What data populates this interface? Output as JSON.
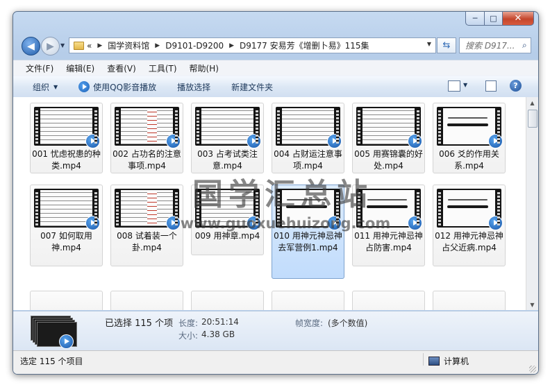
{
  "window": {
    "minimize": "─",
    "maximize": "□",
    "close": "✕"
  },
  "address": {
    "overflow": "«",
    "crumbs": [
      "国学资料馆",
      "D9101-D9200",
      "D9177 安易芳《增删卜易》115集"
    ]
  },
  "search": {
    "placeholder": "搜索 D917..."
  },
  "menu": [
    "文件(F)",
    "编辑(E)",
    "查看(V)",
    "工具(T)",
    "帮助(H)"
  ],
  "toolbar": {
    "organize": "组织",
    "play_with": "使用QQ影音播放",
    "playlist": "播放选择",
    "new_folder": "新建文件夹",
    "help": "?"
  },
  "files": [
    {
      "name": "001 忧虑祝患的种类.mp4",
      "style": "text",
      "selected": false
    },
    {
      "name": "002 占功名的注意事项.mp4",
      "style": "mark",
      "selected": false
    },
    {
      "name": "003 占考试类注意.mp4",
      "style": "text",
      "selected": false
    },
    {
      "name": "004 占财运注意事项.mp4",
      "style": "text",
      "selected": false
    },
    {
      "name": "005 用赛锦囊的好处.mp4",
      "style": "text",
      "selected": false
    },
    {
      "name": "006 爻的作用关系.mp4",
      "style": "hand",
      "selected": false
    },
    {
      "name": "007 如何取用神.mp4",
      "style": "text",
      "selected": false
    },
    {
      "name": "008 试着装一个卦.mp4",
      "style": "mark",
      "selected": false
    },
    {
      "name": "009 用神章.mp4",
      "style": "text",
      "selected": false
    },
    {
      "name": "010 用神元神忌神 去军营例1.mp4",
      "style": "hand",
      "selected": true
    },
    {
      "name": "011 用神元神忌神 占防害.mp4",
      "style": "hand",
      "selected": false
    },
    {
      "name": "012 用神元神忌神 占父近病.mp4",
      "style": "hand",
      "selected": false
    }
  ],
  "watermark": {
    "title": "国学汇总站",
    "url": "www.guoxuehuizong.com"
  },
  "details": {
    "selected": "已选择 115 个项",
    "length_label": "长度:",
    "length_value": "20:51:14",
    "size_label": "大小:",
    "size_value": "4.38 GB",
    "framewidth_label": "帧宽度:",
    "framewidth_value": "(多个数值)"
  },
  "status": {
    "left": "选定 115 个项目",
    "right": "计算机"
  }
}
